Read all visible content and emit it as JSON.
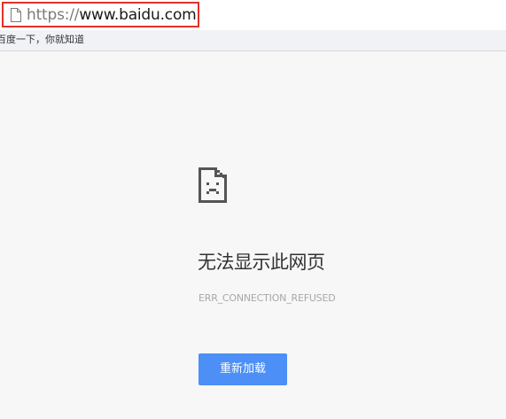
{
  "address_bar": {
    "url_scheme": "https://",
    "url_host": "www.baidu.com",
    "page_icon": "page-icon",
    "highlight_color": "#e0322b"
  },
  "tab": {
    "title": "百度一下，你就知道"
  },
  "error": {
    "icon": "sad-page-icon",
    "title": "无法显示此网页",
    "code": "ERR_CONNECTION_REFUSED",
    "reload_label": "重新加载",
    "button_color": "#4c8ff7"
  }
}
